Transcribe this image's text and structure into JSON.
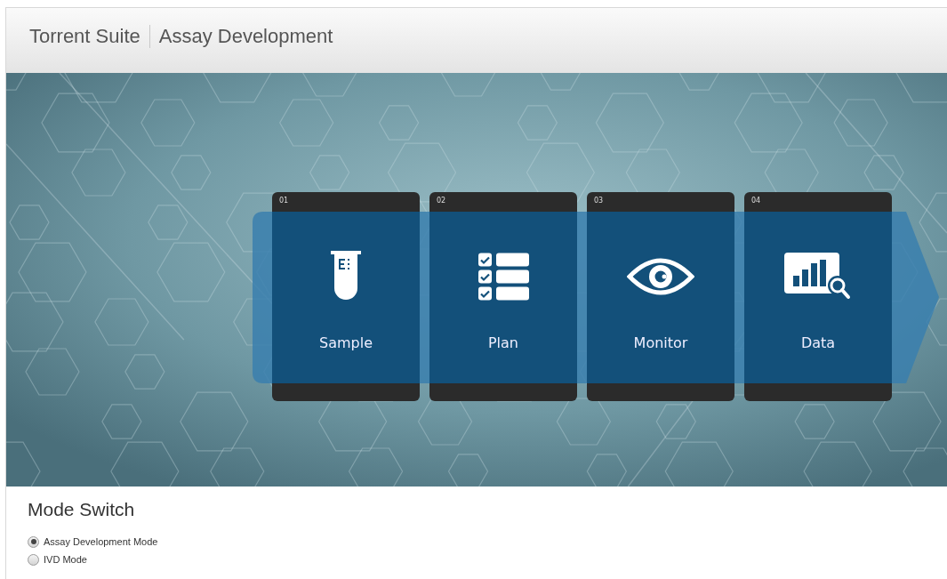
{
  "header": {
    "product": "Torrent Suite",
    "section": "Assay Development"
  },
  "steps": [
    {
      "number": "01",
      "label": "Sample",
      "kind": "tube"
    },
    {
      "number": "02",
      "label": "Plan",
      "kind": "checklist"
    },
    {
      "number": "03",
      "label": "Monitor",
      "kind": "eye"
    },
    {
      "number": "04",
      "label": "Data",
      "kind": "chart"
    }
  ],
  "mode_switch": {
    "title": "Mode Switch",
    "options": [
      {
        "label": "Assay Development Mode",
        "selected": true
      },
      {
        "label": "IVD Mode",
        "selected": false
      }
    ]
  }
}
